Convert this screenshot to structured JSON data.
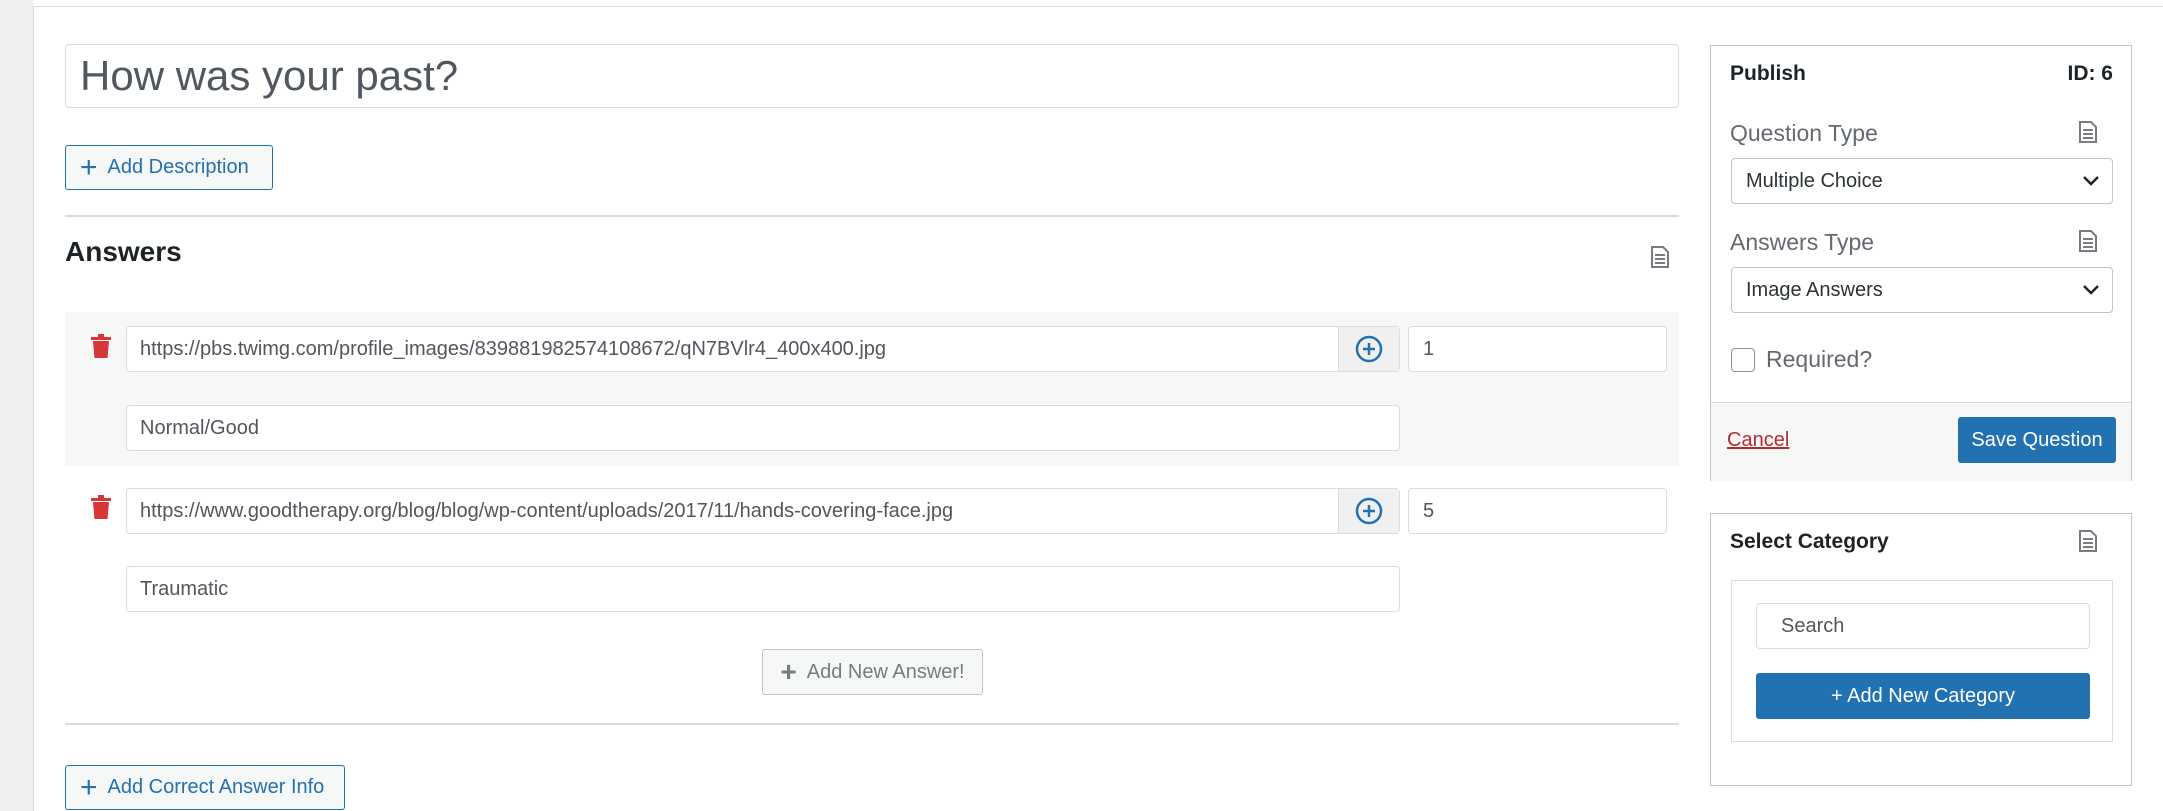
{
  "question": {
    "title": "How was your past?",
    "add_description_label": "Add Description"
  },
  "answers": {
    "heading": "Answers",
    "items": [
      {
        "url": "https://pbs.twimg.com/profile_images/839881982574108672/qN7BVlr4_400x400.jpg",
        "points": "1",
        "text": "Normal/Good"
      },
      {
        "url": "https://www.goodtherapy.org/blog/blog/wp-content/uploads/2017/11/hands-covering-face.jpg",
        "points": "5",
        "text": "Traumatic"
      }
    ],
    "add_new_answer_label": "Add New Answer!",
    "add_correct_answer_info_label": "Add Correct Answer Info"
  },
  "publish": {
    "title": "Publish",
    "id_label": "ID: 6",
    "question_type_label": "Question Type",
    "question_type_value": "Multiple Choice",
    "answers_type_label": "Answers Type",
    "answers_type_value": "Image Answers",
    "required_label": "Required?",
    "cancel_label": "Cancel",
    "save_label": "Save Question"
  },
  "category": {
    "title": "Select Category",
    "search_placeholder": "Search",
    "add_label": "+ Add New Category"
  },
  "colors": {
    "accent": "#2271b1",
    "danger": "#d63638",
    "cancel": "#b32d2e"
  }
}
